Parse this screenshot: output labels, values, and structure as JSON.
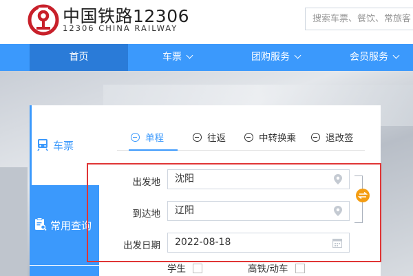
{
  "header": {
    "logo_cn": "中国铁路12306",
    "logo_en": "12306 CHINA RAILWAY",
    "search_placeholder": "搜索车票、餐饮、常旅客"
  },
  "nav": [
    {
      "label": "首页",
      "active": true,
      "dropdown": false
    },
    {
      "label": "车票",
      "active": false,
      "dropdown": true
    },
    {
      "label": "团购服务",
      "active": false,
      "dropdown": true
    },
    {
      "label": "会员服务",
      "active": false,
      "dropdown": true
    }
  ],
  "side_tabs": [
    {
      "label": "车票",
      "icon": "train-icon"
    },
    {
      "label": "常用查询",
      "icon": "clipboard-search-icon"
    }
  ],
  "trip_tabs": [
    {
      "label": "单程",
      "active": true
    },
    {
      "label": "往返",
      "active": false
    },
    {
      "label": "中转换乘",
      "active": false
    },
    {
      "label": "退改签",
      "active": false
    }
  ],
  "form": {
    "from_label": "出发地",
    "from_value": "沈阳",
    "to_label": "到达地",
    "to_value": "辽阳",
    "date_label": "出发日期",
    "date_value": "2022-08-18"
  },
  "checks": {
    "student": "学生",
    "highspeed": "高铁/动车"
  },
  "colors": {
    "brand_blue": "#3b99fc",
    "nav_active": "#2a7bd8",
    "swap_orange": "#f49d12",
    "highlight_red": "#e03535",
    "logo_red": "#c8202a"
  }
}
